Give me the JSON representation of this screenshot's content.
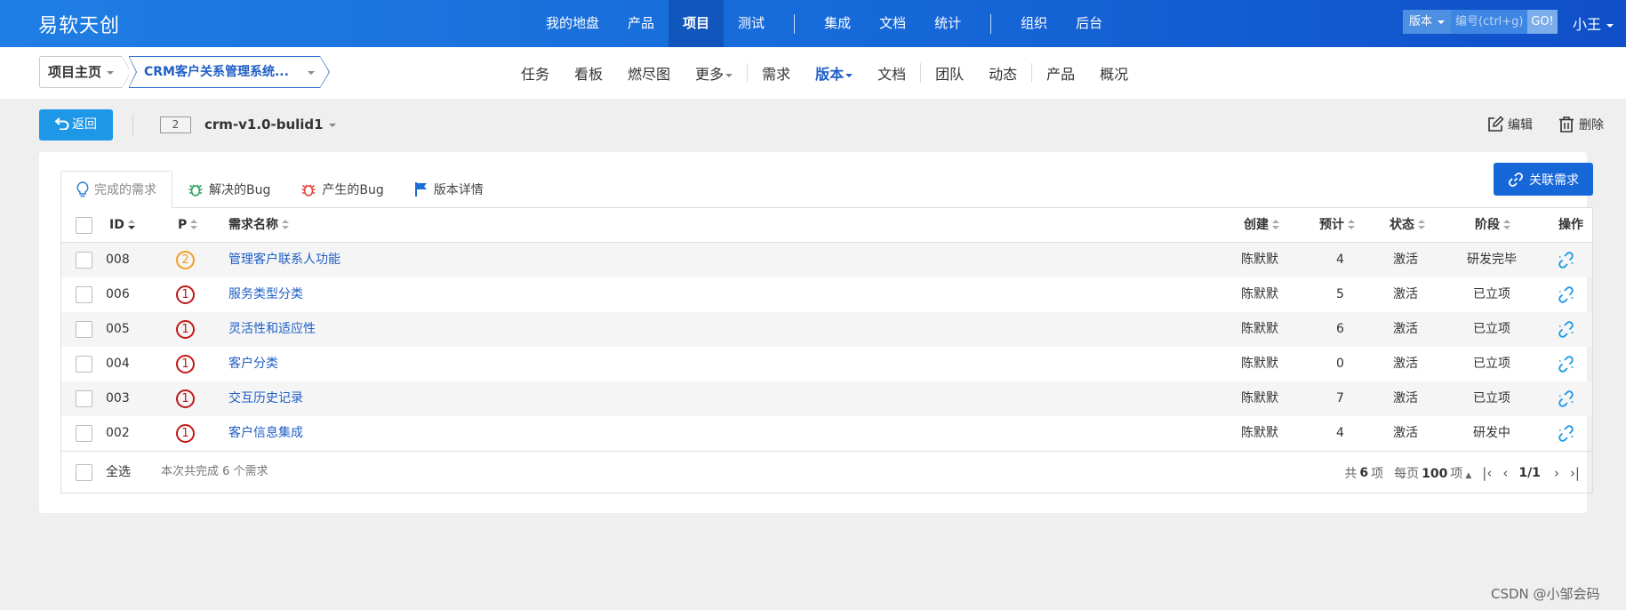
{
  "topbar": {
    "logo": "易软天创",
    "nav": [
      "我的地盘",
      "产品",
      "项目",
      "测试",
      "集成",
      "文档",
      "统计",
      "组织",
      "后台"
    ],
    "active_nav": "项目",
    "search_type": "版本",
    "search_placeholder": "编号(ctrl+g)",
    "search_go": "GO!",
    "user": "小王"
  },
  "breadcrumb": {
    "home": "项目主页",
    "project": "CRM客户关系管理系统..."
  },
  "subnav": {
    "items": [
      "任务",
      "看板",
      "燃尽图",
      "更多",
      "需求",
      "版本",
      "文档",
      "团队",
      "动态",
      "产品",
      "概况"
    ],
    "active": "版本"
  },
  "toolbar": {
    "back_label": "返回",
    "version_badge": "2",
    "version_name": "crm-v1.0-bulid1",
    "edit_label": "编辑",
    "delete_label": "删除"
  },
  "tabs": [
    {
      "label": "完成的需求",
      "icon": "lightbulb-icon"
    },
    {
      "label": "解决的Bug",
      "icon": "bug-icon"
    },
    {
      "label": "产生的Bug",
      "icon": "bug-icon"
    },
    {
      "label": "版本详情",
      "icon": "flag-icon"
    }
  ],
  "link_story_button": "关联需求",
  "table": {
    "headers": {
      "id": "ID",
      "pri": "P",
      "name": "需求名称",
      "creator": "创建",
      "estimate": "预计",
      "status": "状态",
      "stage": "阶段",
      "action": "操作"
    },
    "rows": [
      {
        "id": "008",
        "pri": "2",
        "name": "管理客户联系人功能",
        "creator": "陈默默",
        "estimate": "4",
        "status": "激活",
        "stage": "研发完毕"
      },
      {
        "id": "006",
        "pri": "1",
        "name": "服务类型分类",
        "creator": "陈默默",
        "estimate": "5",
        "status": "激活",
        "stage": "已立项"
      },
      {
        "id": "005",
        "pri": "1",
        "name": "灵活性和适应性",
        "creator": "陈默默",
        "estimate": "6",
        "status": "激活",
        "stage": "已立项"
      },
      {
        "id": "004",
        "pri": "1",
        "name": "客户分类",
        "creator": "陈默默",
        "estimate": "0",
        "status": "激活",
        "stage": "已立项"
      },
      {
        "id": "003",
        "pri": "1",
        "name": "交互历史记录",
        "creator": "陈默默",
        "estimate": "7",
        "status": "激活",
        "stage": "已立项"
      },
      {
        "id": "002",
        "pri": "1",
        "name": "客户信息集成",
        "creator": "陈默默",
        "estimate": "4",
        "status": "激活",
        "stage": "研发中"
      }
    ]
  },
  "footer": {
    "select_all": "全选",
    "summary": "本次共完成 6 个需求",
    "total_prefix": "共",
    "total": "6",
    "total_suffix": "项",
    "per_page_prefix": "每页",
    "per_page": "100",
    "per_page_suffix": "项",
    "page": "1/1"
  },
  "watermark": "CSDN @小邹会码",
  "colors": {
    "primary": "#1668d8",
    "back_button": "#1d97e6",
    "pri_1": "#c21818",
    "pri_2": "#f0a024",
    "link": "#1f5fc5"
  }
}
